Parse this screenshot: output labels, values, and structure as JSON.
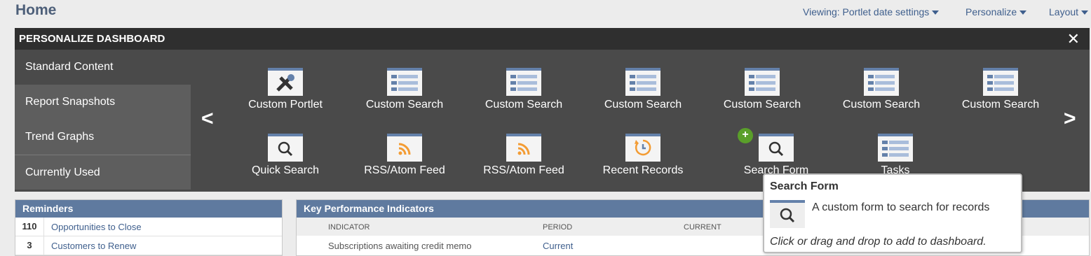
{
  "page": {
    "title": "Home"
  },
  "topnav": {
    "viewing": "Viewing: Portlet date settings",
    "personalize": "Personalize",
    "layout": "Layout"
  },
  "panel": {
    "title": "PERSONALIZE DASHBOARD",
    "close": "✕"
  },
  "sidebar": {
    "items": [
      {
        "label": "Standard Content"
      },
      {
        "label": "Report Snapshots"
      },
      {
        "label": "Trend Graphs"
      },
      {
        "label": "Currently Used"
      }
    ]
  },
  "arrows": {
    "prev": "<",
    "next": ">"
  },
  "tiles": [
    {
      "label": "Custom Portlet",
      "icon": "tools-icon"
    },
    {
      "label": "Custom Search",
      "icon": "list-icon"
    },
    {
      "label": "Custom Search",
      "icon": "list-icon"
    },
    {
      "label": "Custom Search",
      "icon": "list-icon"
    },
    {
      "label": "Custom Search",
      "icon": "list-icon"
    },
    {
      "label": "Custom Search",
      "icon": "list-icon"
    },
    {
      "label": "Custom Search",
      "icon": "list-icon"
    },
    {
      "label": "Quick Search",
      "icon": "magnifier-icon"
    },
    {
      "label": "RSS/Atom Feed",
      "icon": "rss-icon"
    },
    {
      "label": "RSS/Atom Feed",
      "icon": "rss-icon"
    },
    {
      "label": "Recent Records",
      "icon": "history-icon"
    },
    {
      "label": "Search Form",
      "icon": "magnifier-icon"
    },
    {
      "label": "Tasks",
      "icon": "list-icon"
    }
  ],
  "reminders": {
    "title": "Reminders",
    "rows": [
      {
        "count": "110",
        "label": "Opportunities to Close"
      },
      {
        "count": "3",
        "label": "Customers to Renew"
      }
    ]
  },
  "kpi": {
    "title": "Key Performance Indicators",
    "columns": [
      "INDICATOR",
      "PERIOD",
      "CURRENT"
    ],
    "rows": [
      {
        "indicator": "Subscriptions awaiting credit memo",
        "period": "Current"
      }
    ]
  },
  "tooltip": {
    "title": "Search Form",
    "description": "A custom form to search for records",
    "hint": "Click or drag and drop to add to dashboard."
  },
  "colors": {
    "accent": "#6481aa",
    "header": "#5f7a9f",
    "badge": "#5a9f2a"
  }
}
